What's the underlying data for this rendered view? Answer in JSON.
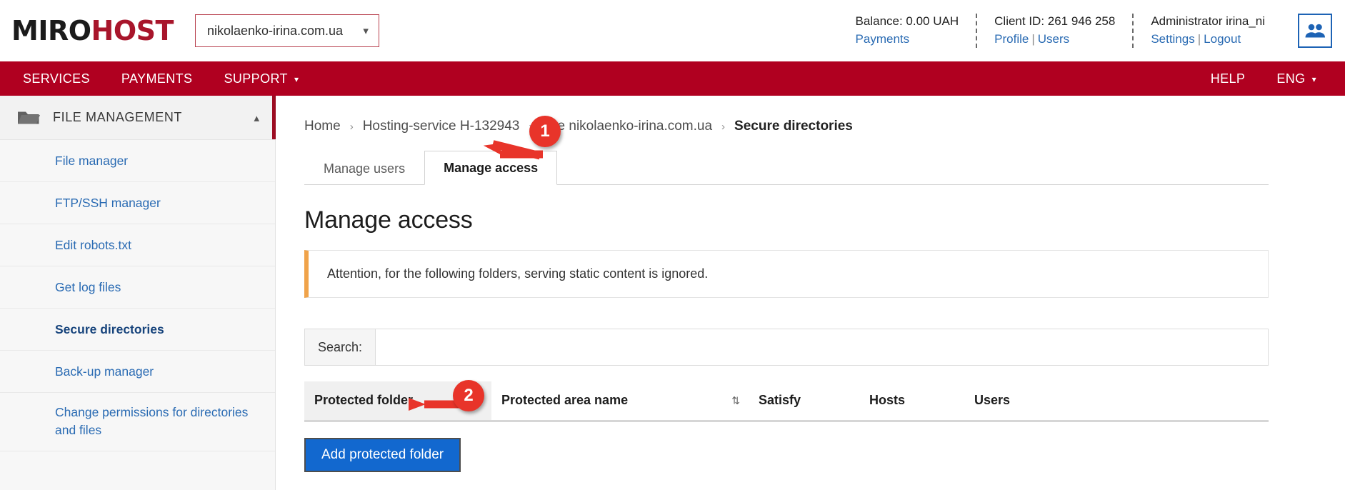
{
  "header": {
    "logo_left": "MIRO",
    "logo_right": "HOST",
    "site_selector_value": "nikolaenko-irina.com.ua",
    "site_selector_caret": "chevron-down",
    "balance_label": "Balance: 0.00 UAH",
    "payments_link": "Payments",
    "client_id_label": "Client ID: 261 946 258",
    "profile_link": "Profile",
    "users_link": "Users",
    "separator": "|",
    "admin_label": "Administrator irina_ni",
    "settings_link": "Settings",
    "logout_link": "Logout",
    "users_icon": "people-icon"
  },
  "nav": {
    "items": [
      {
        "label": "SERVICES",
        "has_caret": false
      },
      {
        "label": "PAYMENTS",
        "has_caret": false
      },
      {
        "label": "SUPPORT",
        "has_caret": true
      }
    ],
    "help_label": "HELP",
    "lang_label": "ENG",
    "lang_has_caret": true
  },
  "sidebar": {
    "section_title": "FILE MANAGEMENT",
    "section_icon": "folder-icon",
    "collapse_icon": "chevron-up-icon",
    "items": [
      {
        "label": "File manager",
        "active": false
      },
      {
        "label": "FTP/SSH manager",
        "active": false
      },
      {
        "label": "Edit robots.txt",
        "active": false
      },
      {
        "label": "Get log files",
        "active": false
      },
      {
        "label": "Secure directories",
        "active": true
      },
      {
        "label": "Back-up manager",
        "active": false
      },
      {
        "label": "Change permissions for directories and files",
        "active": false
      }
    ]
  },
  "breadcrumb": {
    "separator": "›",
    "items": [
      {
        "label": "Home",
        "current": false
      },
      {
        "label": "Hosting-service H-132943",
        "current": false
      },
      {
        "label": "Site nikolaenko-irina.com.ua",
        "current": false
      },
      {
        "label": "Secure directories",
        "current": true
      }
    ]
  },
  "tabs": [
    {
      "label": "Manage users",
      "active": false
    },
    {
      "label": "Manage access",
      "active": true
    }
  ],
  "main": {
    "page_title": "Manage access",
    "alert_text": "Attention, for the following folders, serving static content is ignored.",
    "search_label": "Search:",
    "search_value": "",
    "search_placeholder": "",
    "add_button_label": "Add protected folder"
  },
  "table": {
    "columns": [
      {
        "label": "Protected folder",
        "sort_icon": "↑",
        "sorted": true
      },
      {
        "label": "Protected area name",
        "sort_icon": "⇅",
        "sorted": false
      },
      {
        "label": "Satisfy",
        "sort_icon": "",
        "sorted": false
      },
      {
        "label": "Hosts",
        "sort_icon": "",
        "sorted": false
      },
      {
        "label": "Users",
        "sort_icon": "",
        "sorted": false
      },
      {
        "label": "",
        "sort_icon": "",
        "sorted": false
      }
    ],
    "rows": []
  },
  "annotations": [
    {
      "number": "1",
      "target": "manage-access-tab"
    },
    {
      "number": "2",
      "target": "add-protected-folder-button"
    }
  ],
  "colors": {
    "brand_red": "#b00020",
    "logo_red": "#a8152b",
    "link_blue": "#2a6bb3",
    "button_blue": "#1268cf",
    "alert_orange": "#f0a34a",
    "annotation_red": "#e8342a",
    "sidebar_accent": "#9c0c22"
  }
}
